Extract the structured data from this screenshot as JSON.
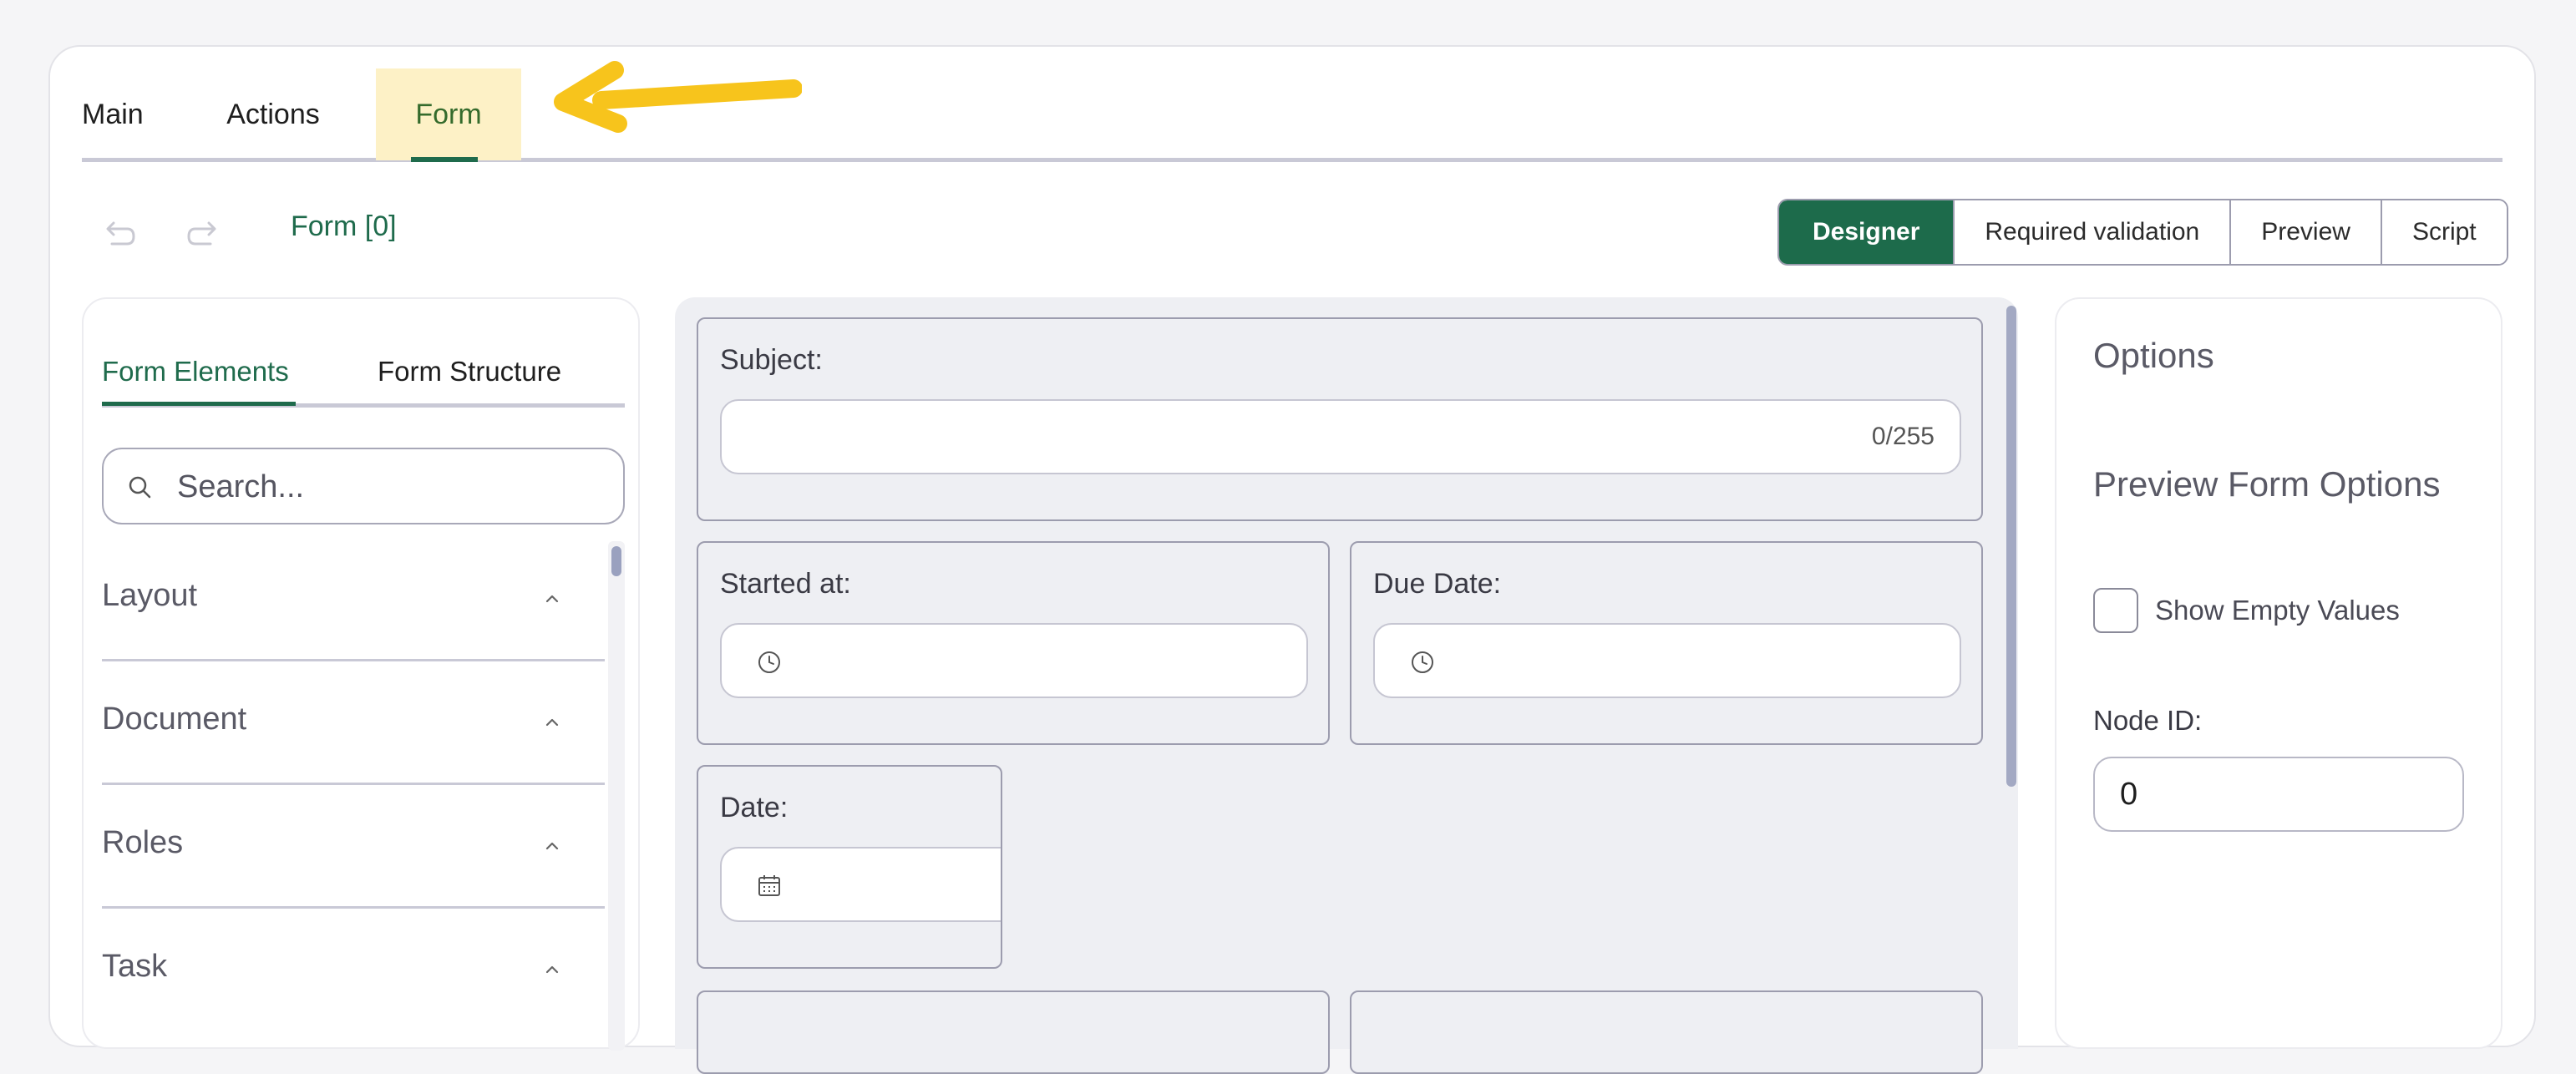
{
  "tabs": {
    "main": "Main",
    "actions": "Actions",
    "form": "Form"
  },
  "accent_color": "#1d6b4b",
  "highlight_color": "#fdf1c6",
  "arrow_color": "#f7c41c",
  "toolbar": {
    "form_title": "Form [0]",
    "modes": [
      "Designer",
      "Required validation",
      "Preview",
      "Script"
    ],
    "active_mode": "Designer"
  },
  "left_panel": {
    "tabs": {
      "elements": "Form Elements",
      "structure": "Form Structure"
    },
    "search_placeholder": "Search...",
    "sections": [
      "Layout",
      "Document",
      "Roles",
      "Task"
    ]
  },
  "canvas": {
    "subject": {
      "label": "Subject:",
      "counter": "0/255"
    },
    "started_at": {
      "label": "Started at:",
      "icon": "clock-icon"
    },
    "due_date": {
      "label": "Due Date:",
      "icon": "clock-icon"
    },
    "date": {
      "label": "Date:",
      "icon": "calendar-icon"
    }
  },
  "right_panel": {
    "title": "Options",
    "subtitle": "Preview Form Options",
    "show_empty_values": "Show Empty Values",
    "node_id_label": "Node ID:",
    "node_id_value": "0"
  }
}
